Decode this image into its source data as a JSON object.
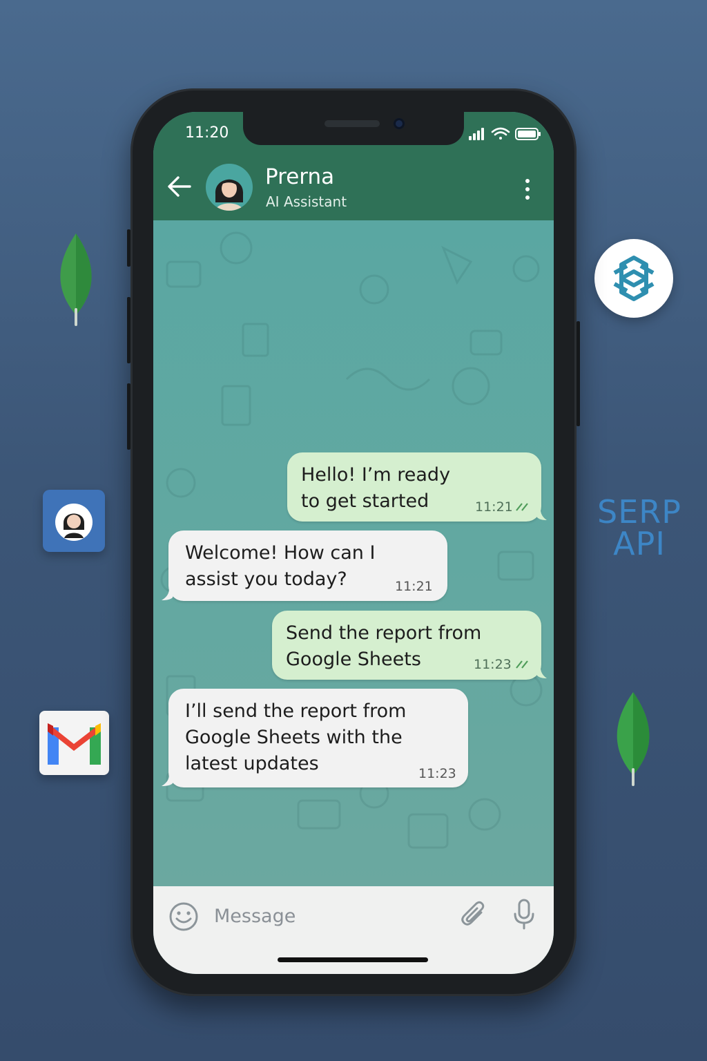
{
  "status_bar": {
    "time": "11:20"
  },
  "chat_header": {
    "name": "Prerna",
    "subtitle": "AI Assistant",
    "icons": [
      "back-arrow-icon",
      "avatar",
      "more-vertical-icon"
    ]
  },
  "messages": [
    {
      "direction": "outgoing",
      "text": "Hello! I’m ready\nto get started",
      "time": "11:21",
      "read": true
    },
    {
      "direction": "incoming",
      "text": "Welcome! How can I\nassist you today?",
      "time": "11:21"
    },
    {
      "direction": "outgoing",
      "text": "Send the report from\nGoogle Sheets",
      "time": "11:23",
      "read": true
    },
    {
      "direction": "incoming",
      "text": "I’ll send the report from\nGoogle Sheets with the\nlatest updates",
      "time": "11:23"
    }
  ],
  "composer": {
    "placeholder": "Message",
    "icons": [
      "emoji-icon",
      "attach-icon",
      "mic-icon"
    ]
  },
  "floating_logos": {
    "serp": {
      "line1": "SERP",
      "line2": "API"
    },
    "icons": [
      "mongodb-leaf-icon",
      "openai-logo-icon",
      "contact-app-icon",
      "gmail-icon"
    ]
  },
  "colors": {
    "header": "#2f7157",
    "chat_background": "#5fa5a0",
    "outgoing_bubble": "#d5efcf",
    "incoming_bubble": "#f2f2f2",
    "background": "#3c5677"
  }
}
